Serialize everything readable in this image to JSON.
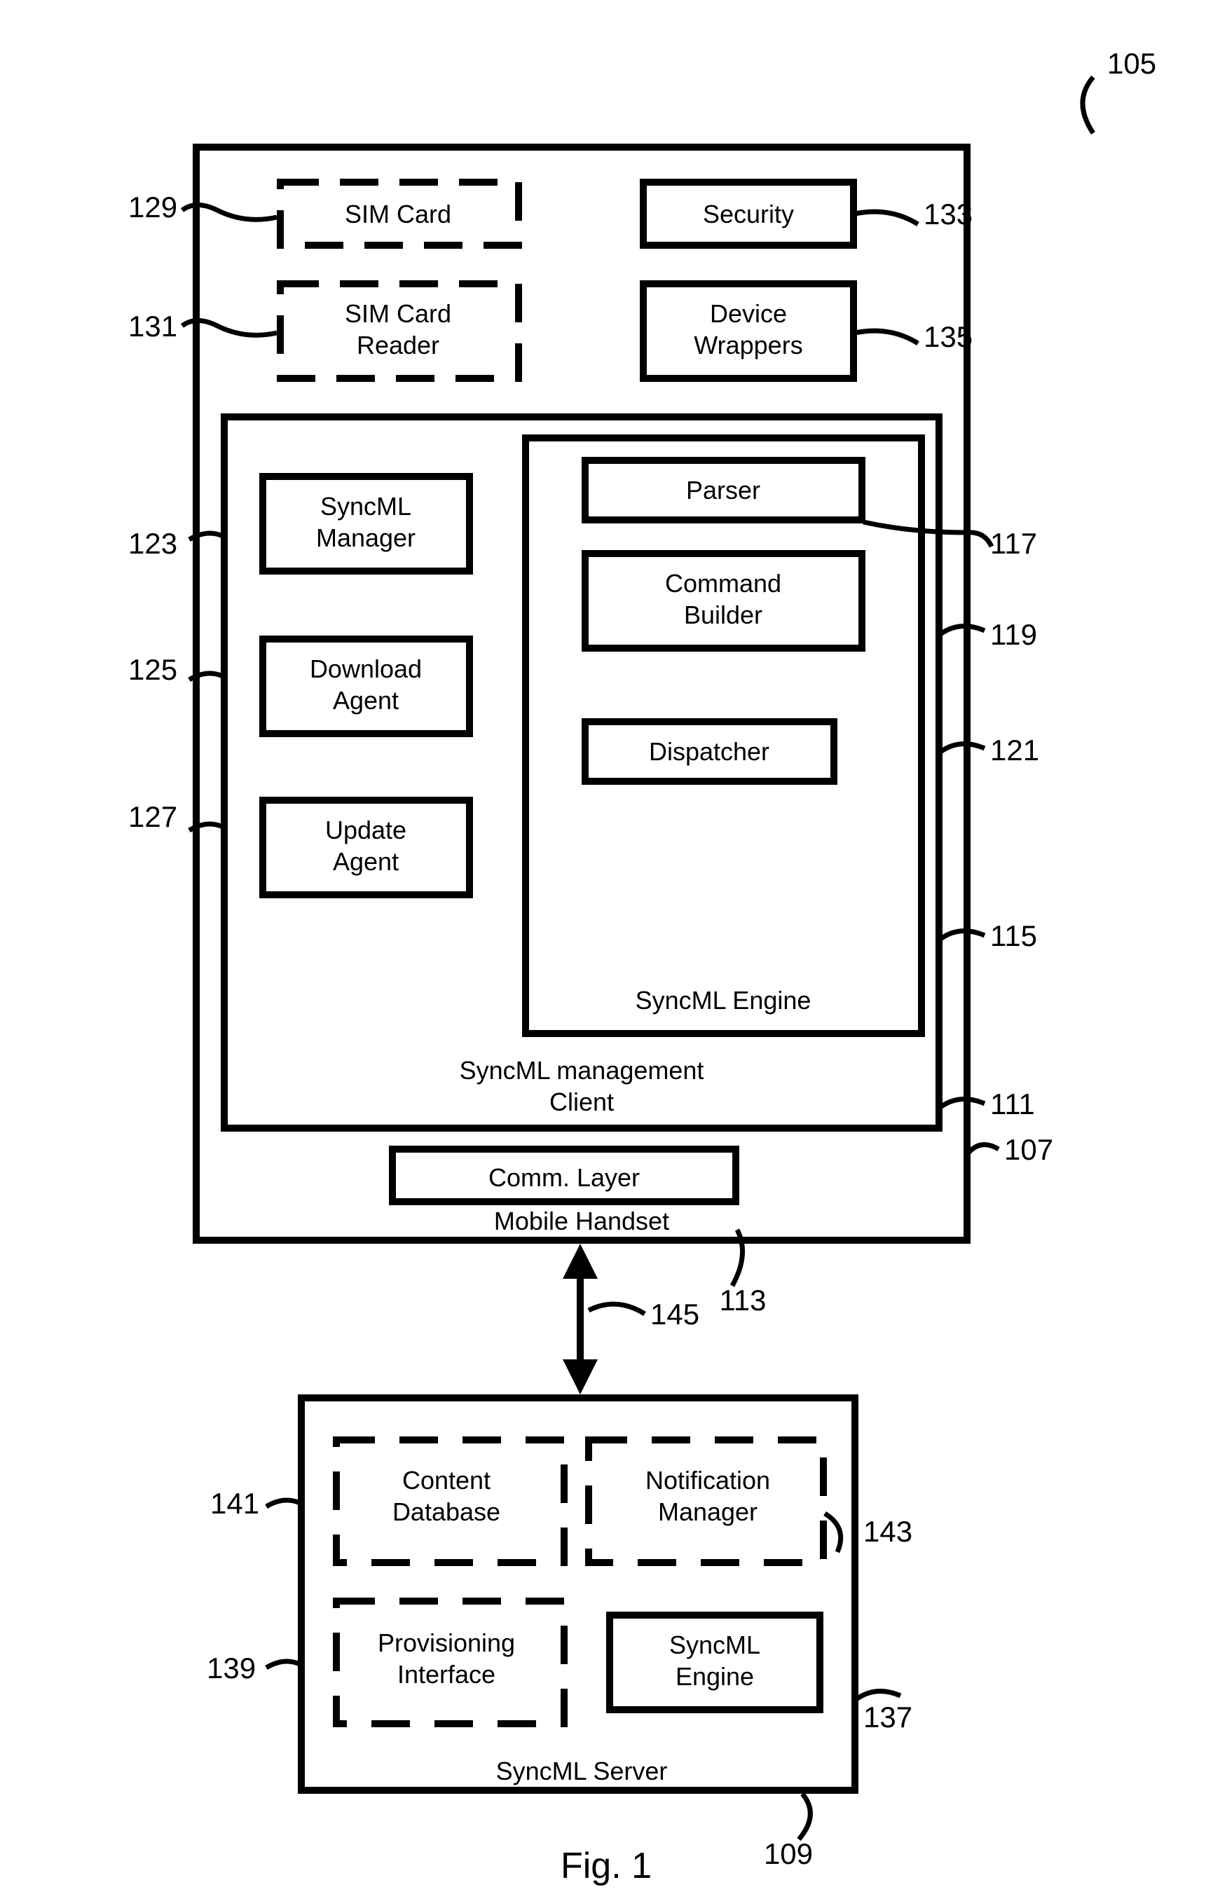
{
  "figure_label": "Fig. 1",
  "diagram_ref": "105",
  "handset": {
    "label": "Mobile Handset",
    "ref": "107",
    "sim_card": {
      "label": "SIM Card",
      "ref": "129"
    },
    "sim_card_reader": {
      "label_line1": "SIM Card",
      "label_line2": "Reader",
      "ref": "131"
    },
    "security": {
      "label": "Security",
      "ref": "133"
    },
    "device_wrappers": {
      "label_line1": "Device",
      "label_line2": "Wrappers",
      "ref": "135"
    },
    "comm_layer": {
      "label": "Comm. Layer",
      "ref": "113"
    },
    "client": {
      "label_line1": "SyncML management",
      "label_line2": "Client",
      "ref": "111",
      "syncml_manager": {
        "label_line1": "SyncML",
        "label_line2": "Manager",
        "ref": "123"
      },
      "download_agent": {
        "label_line1": "Download",
        "label_line2": "Agent",
        "ref": "125"
      },
      "update_agent": {
        "label_line1": "Update",
        "label_line2": "Agent",
        "ref": "127"
      },
      "engine": {
        "label": "SyncML Engine",
        "ref": "115",
        "parser": {
          "label": "Parser",
          "ref": "117"
        },
        "command_builder": {
          "label_line1": "Command",
          "label_line2": "Builder",
          "ref": "119"
        },
        "dispatcher": {
          "label": "Dispatcher",
          "ref": "121"
        }
      }
    }
  },
  "link_ref": "145",
  "server": {
    "label": "SyncML Server",
    "ref": "109",
    "content_database": {
      "label_line1": "Content",
      "label_line2": "Database",
      "ref": "141"
    },
    "notification_manager": {
      "label_line1": "Notification",
      "label_line2": "Manager",
      "ref": "143"
    },
    "provisioning_interface": {
      "label_line1": "Provisioning",
      "label_line2": "Interface",
      "ref": "139"
    },
    "syncml_engine": {
      "label_line1": "SyncML",
      "label_line2": "Engine",
      "ref": "137"
    }
  }
}
